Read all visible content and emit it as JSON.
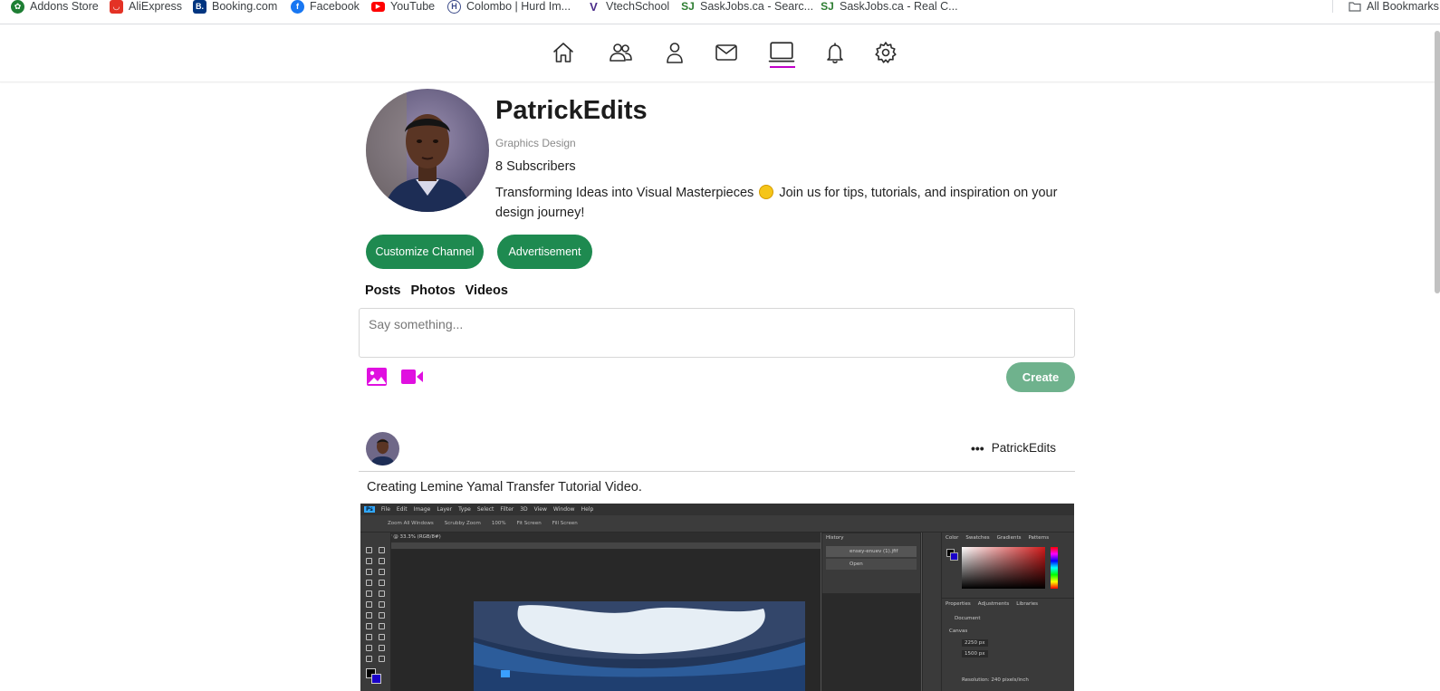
{
  "bookmarks": {
    "items": [
      {
        "label": "Addons Store",
        "color": "#1e7e34"
      },
      {
        "label": "AliExpress",
        "color": "#e43225"
      },
      {
        "label": "Booking.com",
        "color": "#003580"
      },
      {
        "label": "Facebook",
        "color": "#1877f2"
      },
      {
        "label": "YouTube",
        "color": "#ff0000"
      },
      {
        "label": "Colombo | Hurd Im...",
        "color": "#3c4b8a"
      },
      {
        "label": "VtechSchool",
        "color": "#4b2c8a"
      },
      {
        "label": "SaskJobs.ca - Searc...",
        "color": "#2e7d32"
      },
      {
        "label": "SaskJobs.ca - Real C...",
        "color": "#2e7d32"
      }
    ],
    "all_bookmarks": "All Bookmarks"
  },
  "nav": {
    "icons": [
      "home-icon",
      "friends-icon",
      "profile-icon",
      "mail-icon",
      "channel-icon",
      "bell-icon",
      "gear-icon"
    ],
    "active": "channel-icon",
    "accent": "#c000c8"
  },
  "profile": {
    "name": "PatrickEdits",
    "category": "Graphics Design",
    "subscribers": "8 Subscribers",
    "bio_part1": "Transforming Ideas into Visual Masterpieces",
    "bio_part2": " Join us for tips, tutorials, and inspiration on your design journey!"
  },
  "buttons": {
    "customize": "Customize Channel",
    "advertisement": "Advertisement",
    "green": "#1e8a50"
  },
  "tabs": [
    "Posts",
    "Photos",
    "Videos"
  ],
  "composer": {
    "placeholder": "Say something...",
    "create": "Create",
    "icon_color": "#e010e0"
  },
  "post": {
    "author": "PatrickEdits",
    "text": "Creating Lemine Yamal Transfer Tutorial Video."
  },
  "photoshop": {
    "menu": [
      "File",
      "Edit",
      "Image",
      "Layer",
      "Type",
      "Select",
      "Filter",
      "3D",
      "View",
      "Window",
      "Help"
    ],
    "options": [
      "Zoom All Windows",
      "Scrubby Zoom",
      "100%",
      "Fit Screen",
      "Fill Screen"
    ],
    "doc_tab": "(1).jfif @ 33.3% (RGB/8#)",
    "history_title": "History",
    "history_rows": [
      "ensey-enuev (1).jfif",
      "Open"
    ],
    "right_tabs": [
      "Color",
      "Swatches",
      "Gradients",
      "Patterns"
    ],
    "props_tabs": [
      "Properties",
      "Adjustments",
      "Libraries"
    ],
    "props_doc": "Document",
    "canvas_label": "Canvas",
    "width": "2250 px",
    "height": "1500 px",
    "resolution": "Resolution: 240 pixels/inch"
  }
}
